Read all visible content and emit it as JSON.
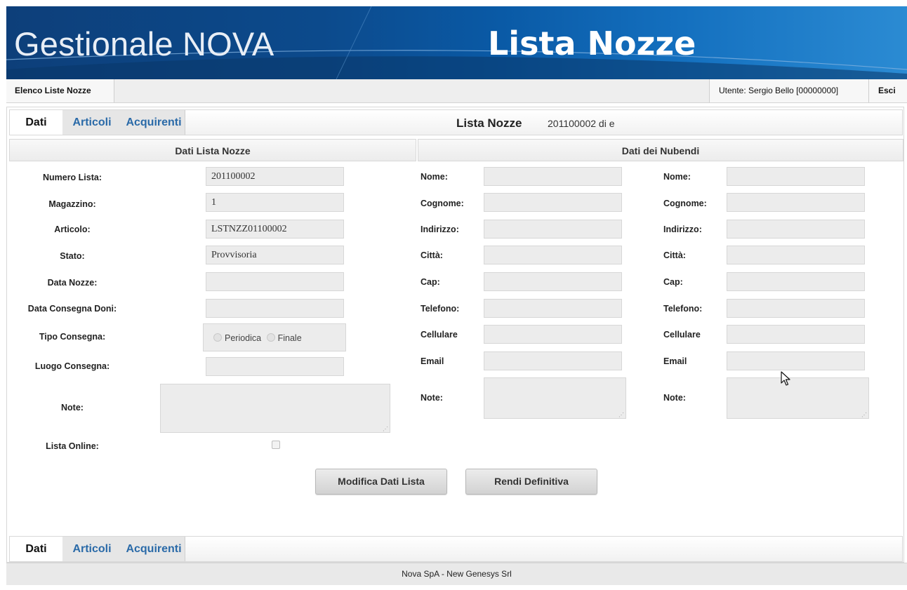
{
  "header": {
    "app_name": "Gestionale NOVA",
    "module_name": "Lista Nozze"
  },
  "topbar": {
    "elenco_label": "Elenco Liste Nozze",
    "user_label": "Utente: Sergio Bello [00000000]",
    "logout_label": "Esci"
  },
  "tabs": {
    "dati": "Dati",
    "articoli": "Articoli",
    "acquirenti": "Acquirenti"
  },
  "title": {
    "label": "Lista Nozze",
    "code": "201100002 di e"
  },
  "sections": {
    "left": "Dati Lista Nozze",
    "right": "Dati dei Nubendi"
  },
  "lista": {
    "numero_label": "Numero Lista:",
    "numero_value": "201100002",
    "magazzino_label": "Magazzino:",
    "magazzino_value": "1",
    "articolo_label": "Articolo:",
    "articolo_value": "LSTNZZ01100002",
    "stato_label": "Stato:",
    "stato_value": "Provvisoria",
    "data_nozze_label": "Data Nozze:",
    "data_consegna_label": "Data Consegna Doni:",
    "tipo_consegna_label": "Tipo Consegna:",
    "tipo_periodica": "Periodica",
    "tipo_finale": "Finale",
    "luogo_label": "Luogo Consegna:",
    "note_label": "Note:",
    "online_label": "Lista Online:"
  },
  "nubendi": {
    "nome": "Nome:",
    "cognome": "Cognome:",
    "indirizzo": "Indirizzo:",
    "citta": "Città:",
    "cap": "Cap:",
    "telefono": "Telefono:",
    "cellulare": "Cellulare",
    "email": "Email",
    "note": "Note:"
  },
  "buttons": {
    "modifica": "Modifica Dati Lista",
    "definitiva": "Rendi Definitiva"
  },
  "footer": {
    "text": "Nova SpA - New Genesys Srl"
  }
}
